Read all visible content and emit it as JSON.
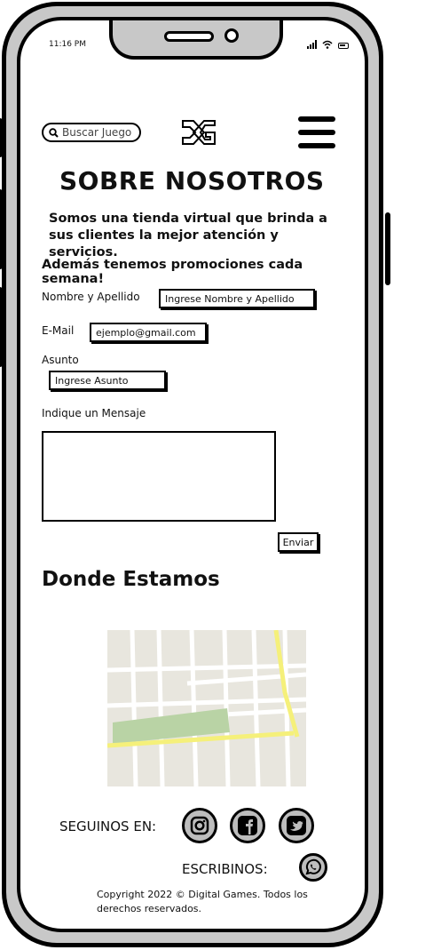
{
  "status_bar": {
    "time": "11:16 PM"
  },
  "header": {
    "search_placeholder": "Buscar Juego",
    "logo_text": "DG"
  },
  "about": {
    "title": "SOBRE NOSOTROS",
    "intro": "Somos una tienda virtual que brinda a sus clientes la mejor atención y servicios.",
    "promo": "Además tenemos promociones cada semana!"
  },
  "form": {
    "name_label": "Nombre y Apellido",
    "name_placeholder": "Ingrese Nombre y Apellido",
    "email_label": "E-Mail",
    "email_placeholder": "ejemplo@gmail.com",
    "subject_label": "Asunto",
    "subject_placeholder": "Ingrese Asunto",
    "message_label": "Indique un Mensaje",
    "send_label": "Enviar"
  },
  "location": {
    "title": "Donde Estamos"
  },
  "footer": {
    "follow_label": "SEGUINOS EN:",
    "write_label": "ESCRIBINOS:",
    "copyright": "Copyright 2022 © Digital Games. Todos los derechos reservados."
  },
  "icons": {
    "search": "search-icon",
    "menu": "hamburger-menu-icon",
    "instagram": "instagram-icon",
    "facebook": "facebook-icon",
    "twitter": "twitter-icon",
    "whatsapp": "whatsapp-icon"
  },
  "colors": {
    "frame": "#c8c8c8",
    "map_park": "#b9d3a5",
    "map_road": "#f5f07a",
    "map_base": "#e8e6de"
  }
}
